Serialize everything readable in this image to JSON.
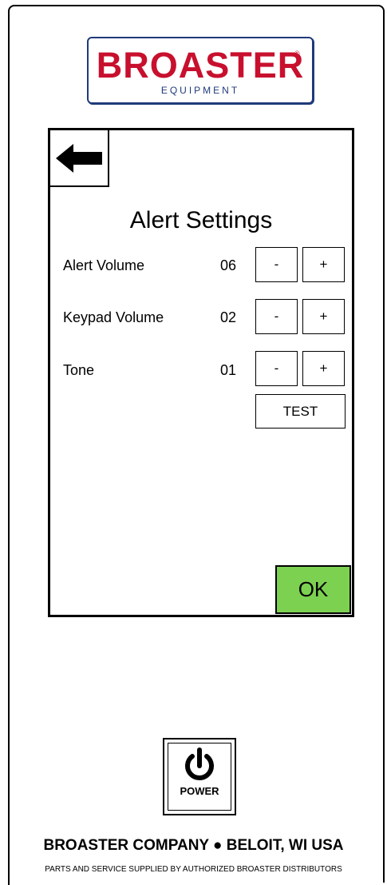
{
  "logo": {
    "brand": "BROASTER",
    "registered": "®",
    "subtitle": "EQUIPMENT"
  },
  "screen": {
    "back_icon": "arrow-left-icon",
    "title": "Alert Settings",
    "settings": [
      {
        "label": "Alert Volume",
        "value": "06",
        "minus": "-",
        "plus": "+"
      },
      {
        "label": "Keypad Volume",
        "value": "02",
        "minus": "-",
        "plus": "+"
      },
      {
        "label": "Tone",
        "value": "01",
        "minus": "-",
        "plus": "+"
      }
    ],
    "test_label": "TEST",
    "ok_label": "OK",
    "ok_color": "#7dd151"
  },
  "power": {
    "icon": "power-icon",
    "label": "POWER"
  },
  "footer": {
    "company": "BROASTER COMPANY ● BELOIT, WI USA",
    "note": "PARTS AND SERVICE SUPPLIED BY AUTHORIZED BROASTER DISTRIBUTORS"
  },
  "colors": {
    "brand_red": "#c8102e",
    "brand_blue": "#1f3a7a"
  }
}
